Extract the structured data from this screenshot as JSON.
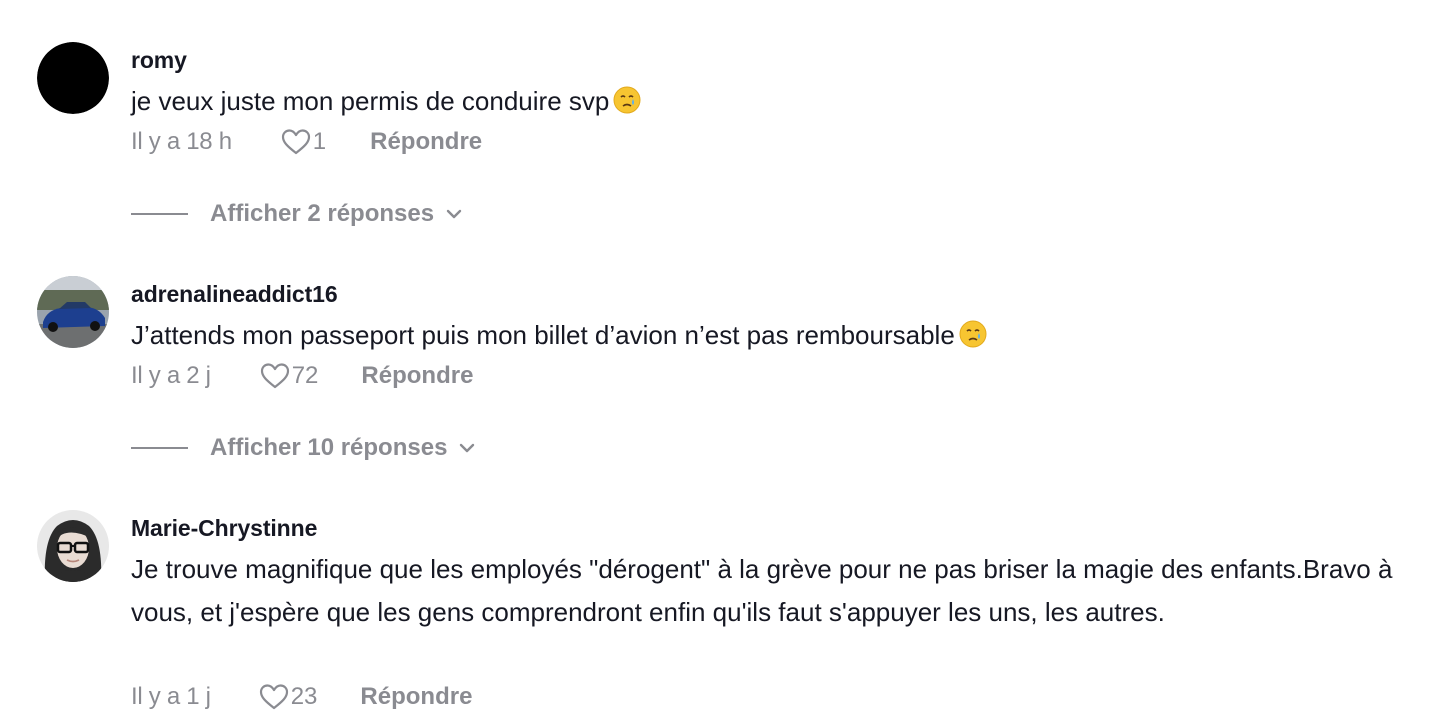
{
  "comments": [
    {
      "username": "romy",
      "text": "je veux juste mon permis de conduire svp",
      "emoji": "crying-face",
      "time": "Il y a 18 h",
      "likes": "1",
      "reply_label": "Répondre",
      "replies_label": "Afficher 2 réponses"
    },
    {
      "username": "adrenalineaddict16",
      "text": "J’attends mon passeport puis mon billet d’avion n’est pas remboursable",
      "emoji": "crying-face",
      "time": "Il y a 2 j",
      "likes": "72",
      "reply_label": "Répondre",
      "replies_label": "Afficher 10 réponses"
    },
    {
      "username": "Marie-Chrystinne",
      "text": "Je trouve magnifique que les employés \"dérogent\" à la grève pour ne pas briser la magie des enfants.Bravo à vous, et j'espère que les gens comprendront enfin qu'ils faut s'appuyer les uns, les autres.",
      "time": "Il y a 1 j",
      "likes": "23",
      "reply_label": "Répondre"
    }
  ],
  "icons": {
    "like": "heart-outline-icon",
    "expand": "chevron-down-icon",
    "emoji": "crying-face-emoji"
  },
  "colors": {
    "text": "#161823",
    "muted": "#8a8b91",
    "emoji": "#f7c531",
    "tear": "#5ab0f0"
  }
}
